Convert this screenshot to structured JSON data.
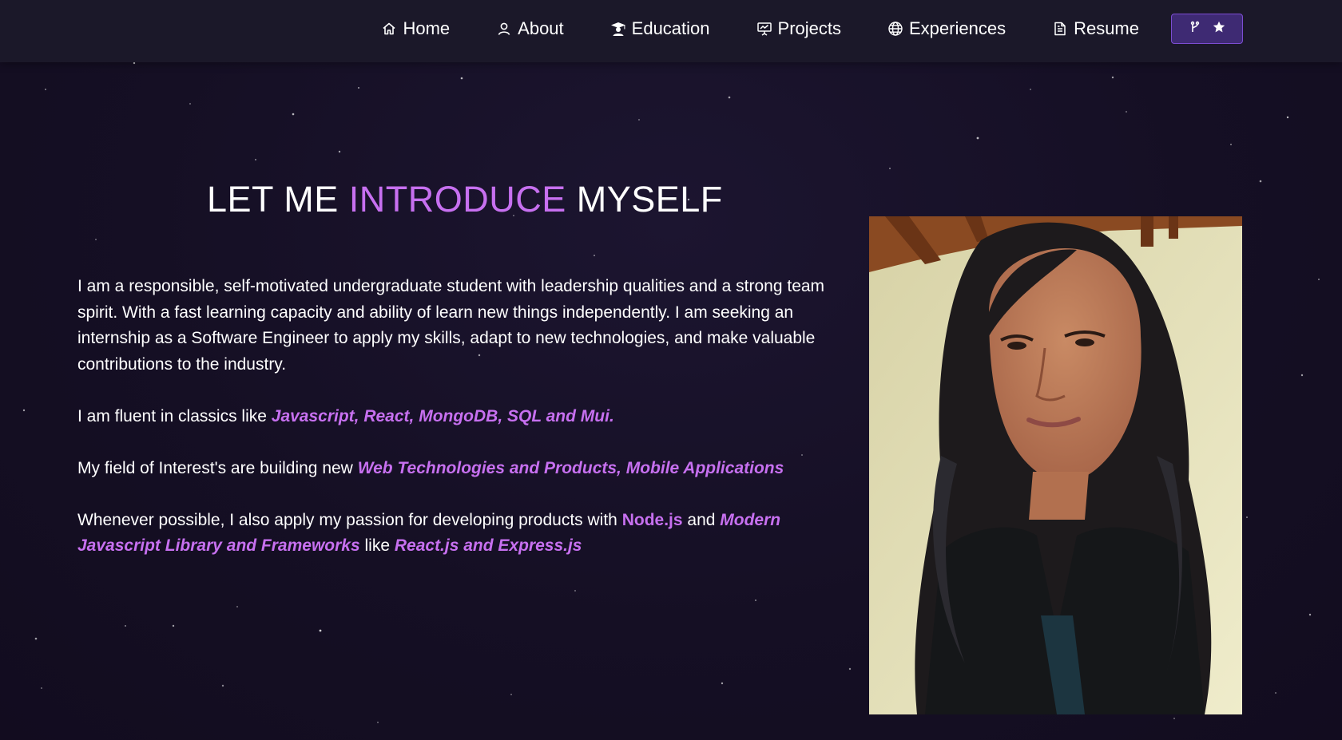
{
  "nav": {
    "items": [
      {
        "label": "Home",
        "icon": "home-icon"
      },
      {
        "label": "About",
        "icon": "user-icon"
      },
      {
        "label": "Education",
        "icon": "graduation-icon"
      },
      {
        "label": "Projects",
        "icon": "presentation-icon"
      },
      {
        "label": "Experiences",
        "icon": "globe-icon"
      },
      {
        "label": "Resume",
        "icon": "document-icon"
      }
    ],
    "fork_button": {
      "icons": [
        "git-fork-icon",
        "star-icon"
      ]
    }
  },
  "hero": {
    "heading": {
      "part1": "LET ME ",
      "accent": "INTRODUCE",
      "part2": " MYSELF"
    },
    "paragraphs": {
      "intro": "I am a responsible, self-motivated undergraduate student with leadership qualities and a strong team spirit. With a fast learning capacity and ability of learn new things independently. I am seeking an internship as a Software Engineer to apply my skills, adapt to new technologies, and make valuable contributions to the industry.",
      "classics_lead": "I am fluent in classics like ",
      "classics_hl": "Javascript, React, MongoDB, SQL and Mui.",
      "interest_lead": "My field of Interest's are building new ",
      "interest_hl": "Web Technologies and Products, Mobile Applications",
      "passion_lead": "Whenever possible, I also apply my passion for developing products with ",
      "passion_node": "Node.js",
      "passion_and": " and ",
      "passion_modern": "Modern Javascript Library and Frameworks",
      "passion_like": " like ",
      "passion_react": "React.js and Express.js"
    }
  },
  "colors": {
    "accent": "#c770f0",
    "background": "#150f24",
    "navbar": "#1b1829",
    "fork_button": "#3e2a73"
  }
}
